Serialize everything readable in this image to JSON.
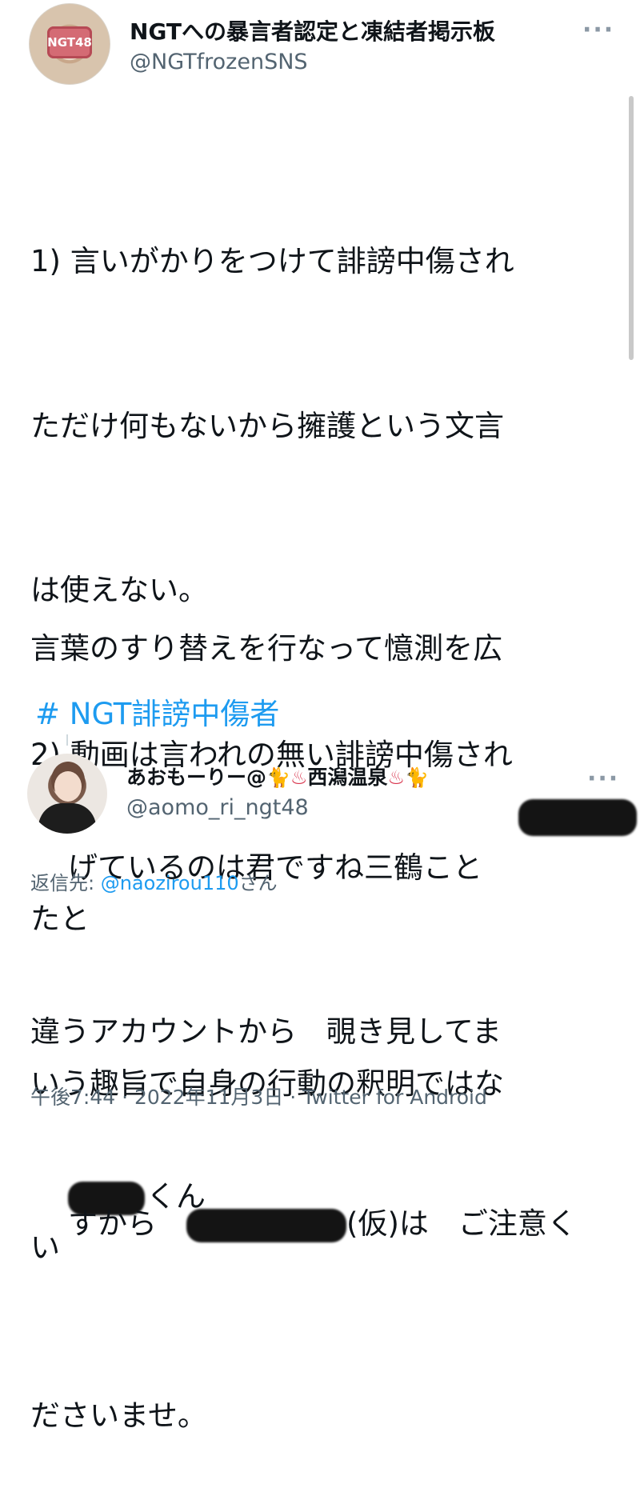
{
  "tweet": {
    "author": {
      "display_name": "NGTへの暴言者認定と凍結者掲示板",
      "handle": "@NGTfrozenSNS",
      "avatar_badge": "NGT48"
    },
    "more_icon": "more-horizontal-icon",
    "body_lines": [
      "1) 言いがかりをつけて誹謗中傷され",
      "ただけ何もないから擁護という文言",
      "は使えない。",
      "2) 動画は言われの無い誹謗中傷され",
      "たと",
      "いう趣旨で自身の行動の釈明ではな",
      "い"
    ],
    "body2_line1": "言葉のすり替えを行なって憶測を広",
    "body2_line2": "げているのは君ですね三鶴こと",
    "body2_line3_suffix": "くん",
    "hashtag": "# NGT誹謗中傷者"
  },
  "quoted": {
    "author": {
      "display_name_prefix": "あおもーりー@",
      "display_name_middle": "西潟温泉",
      "handle": "@aomo_ri_ngt48"
    },
    "emoji_icons": [
      "cat-icon",
      "hot-springs-icon",
      "hot-springs-icon",
      "cat-icon"
    ],
    "reply_to_label": "返信先: ",
    "reply_to_user": "@naozirou110",
    "reply_to_suffix": "さん",
    "text_line1": "違うアカウントから　覗き見してま",
    "text_line2_prefix": "すから　",
    "text_line2_suffix": "(仮)は　ご注意く",
    "text_line3": "ださいませ。",
    "timestamp": "午後7:44 · 2022年11月3日 · Twitter for Android"
  },
  "colors": {
    "link": "#1d9bf0",
    "text": "#0f1419",
    "secondary": "#536471"
  }
}
